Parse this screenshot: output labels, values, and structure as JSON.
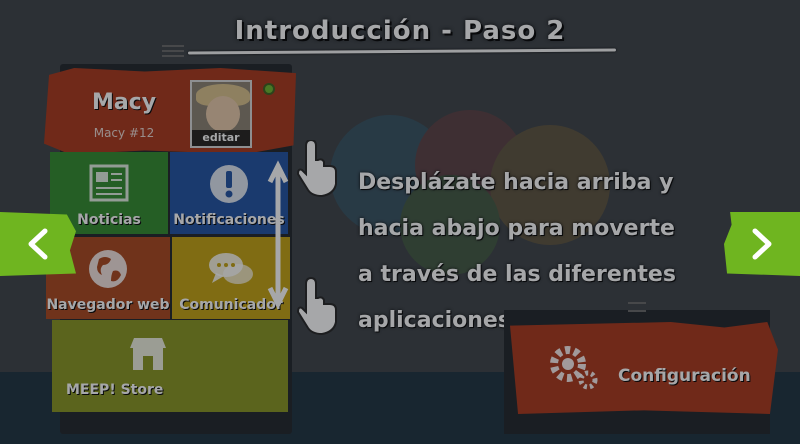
{
  "title": "Introducción - Paso 2",
  "profile": {
    "name": "Macy",
    "id_label": "Macy #12",
    "edit_label": "editar",
    "status_color": "#6ab52a"
  },
  "apps": [
    {
      "label": "Noticias",
      "icon": "newspaper-icon",
      "color": "#2f8a2a"
    },
    {
      "label": "Notificaciones",
      "icon": "exclamation-icon",
      "color": "#1d4fa0"
    },
    {
      "label": "Navegador web",
      "icon": "globe-icon",
      "color": "#a8441b"
    },
    {
      "label": "Comunicador",
      "icon": "chat-bubbles-icon",
      "color": "#c2a10e"
    },
    {
      "label": "MEEP! Store",
      "icon": "store-icon",
      "color": "#86941e"
    }
  ],
  "instruction": {
    "line1": "Desplázate hacia arriba y",
    "line2": "hacia abajo para moverte",
    "line3": "a través de las diferentes",
    "line4": "aplicaciones"
  },
  "config": {
    "label": "Configuración",
    "icon": "gears-icon"
  },
  "nav": {
    "prev_icon": "chevron-left-icon",
    "next_icon": "chevron-right-icon",
    "accent_color": "#6fb520"
  }
}
